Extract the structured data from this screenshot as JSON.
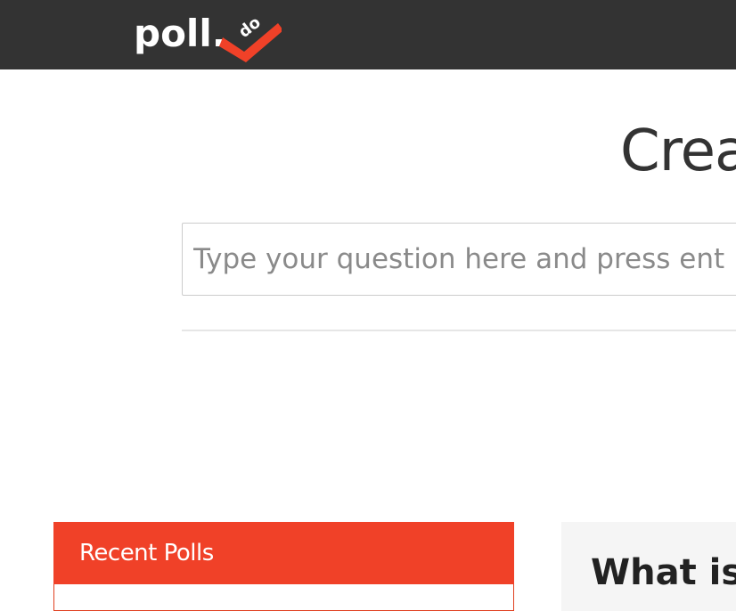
{
  "header": {
    "logo_text": "poll.",
    "logo_badge_text": "do",
    "background_color": "#333333",
    "brand_color": "#f04128"
  },
  "main": {
    "title": "Crea",
    "question_placeholder": "Type your question here and press ent"
  },
  "recent_polls": {
    "title": "Recent Polls"
  },
  "info": {
    "title": "What is"
  }
}
